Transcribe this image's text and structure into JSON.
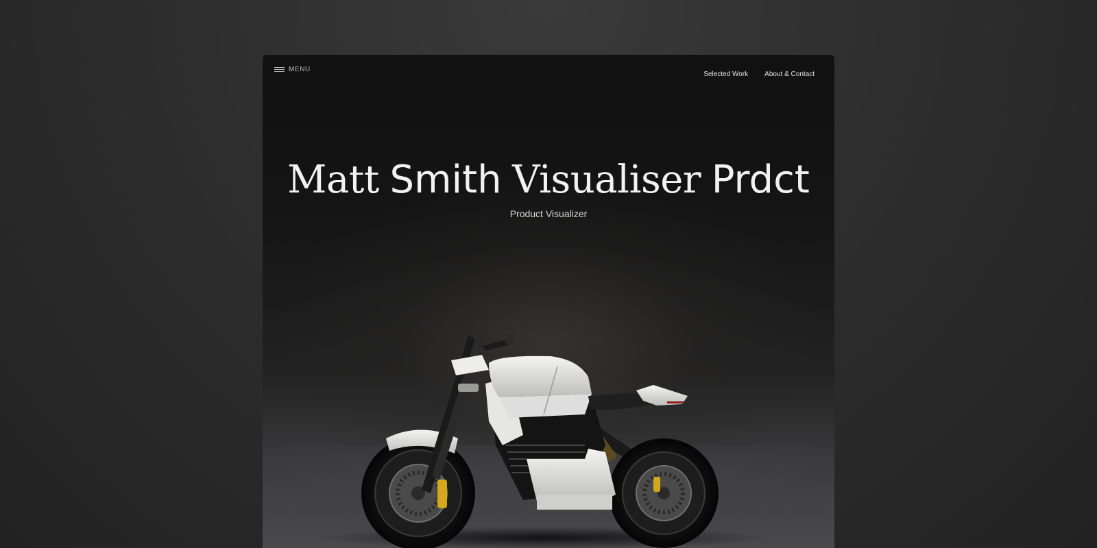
{
  "menu": {
    "label": "MENU"
  },
  "nav": {
    "selected_work": "Selected Work",
    "about_contact": "About & Contact"
  },
  "hero": {
    "title_part1": "Matt",
    "title_part2": "Smith",
    "title_part3": "Visualiser",
    "title_part4": "Prdct",
    "subtitle": "Product Visualizer",
    "image": "motorcycle-render"
  },
  "colors": {
    "page_background": "#2e2e2e",
    "frame_background": "#111111",
    "text": "#f2f2f2",
    "brake_caliper": "#d4a81c"
  }
}
